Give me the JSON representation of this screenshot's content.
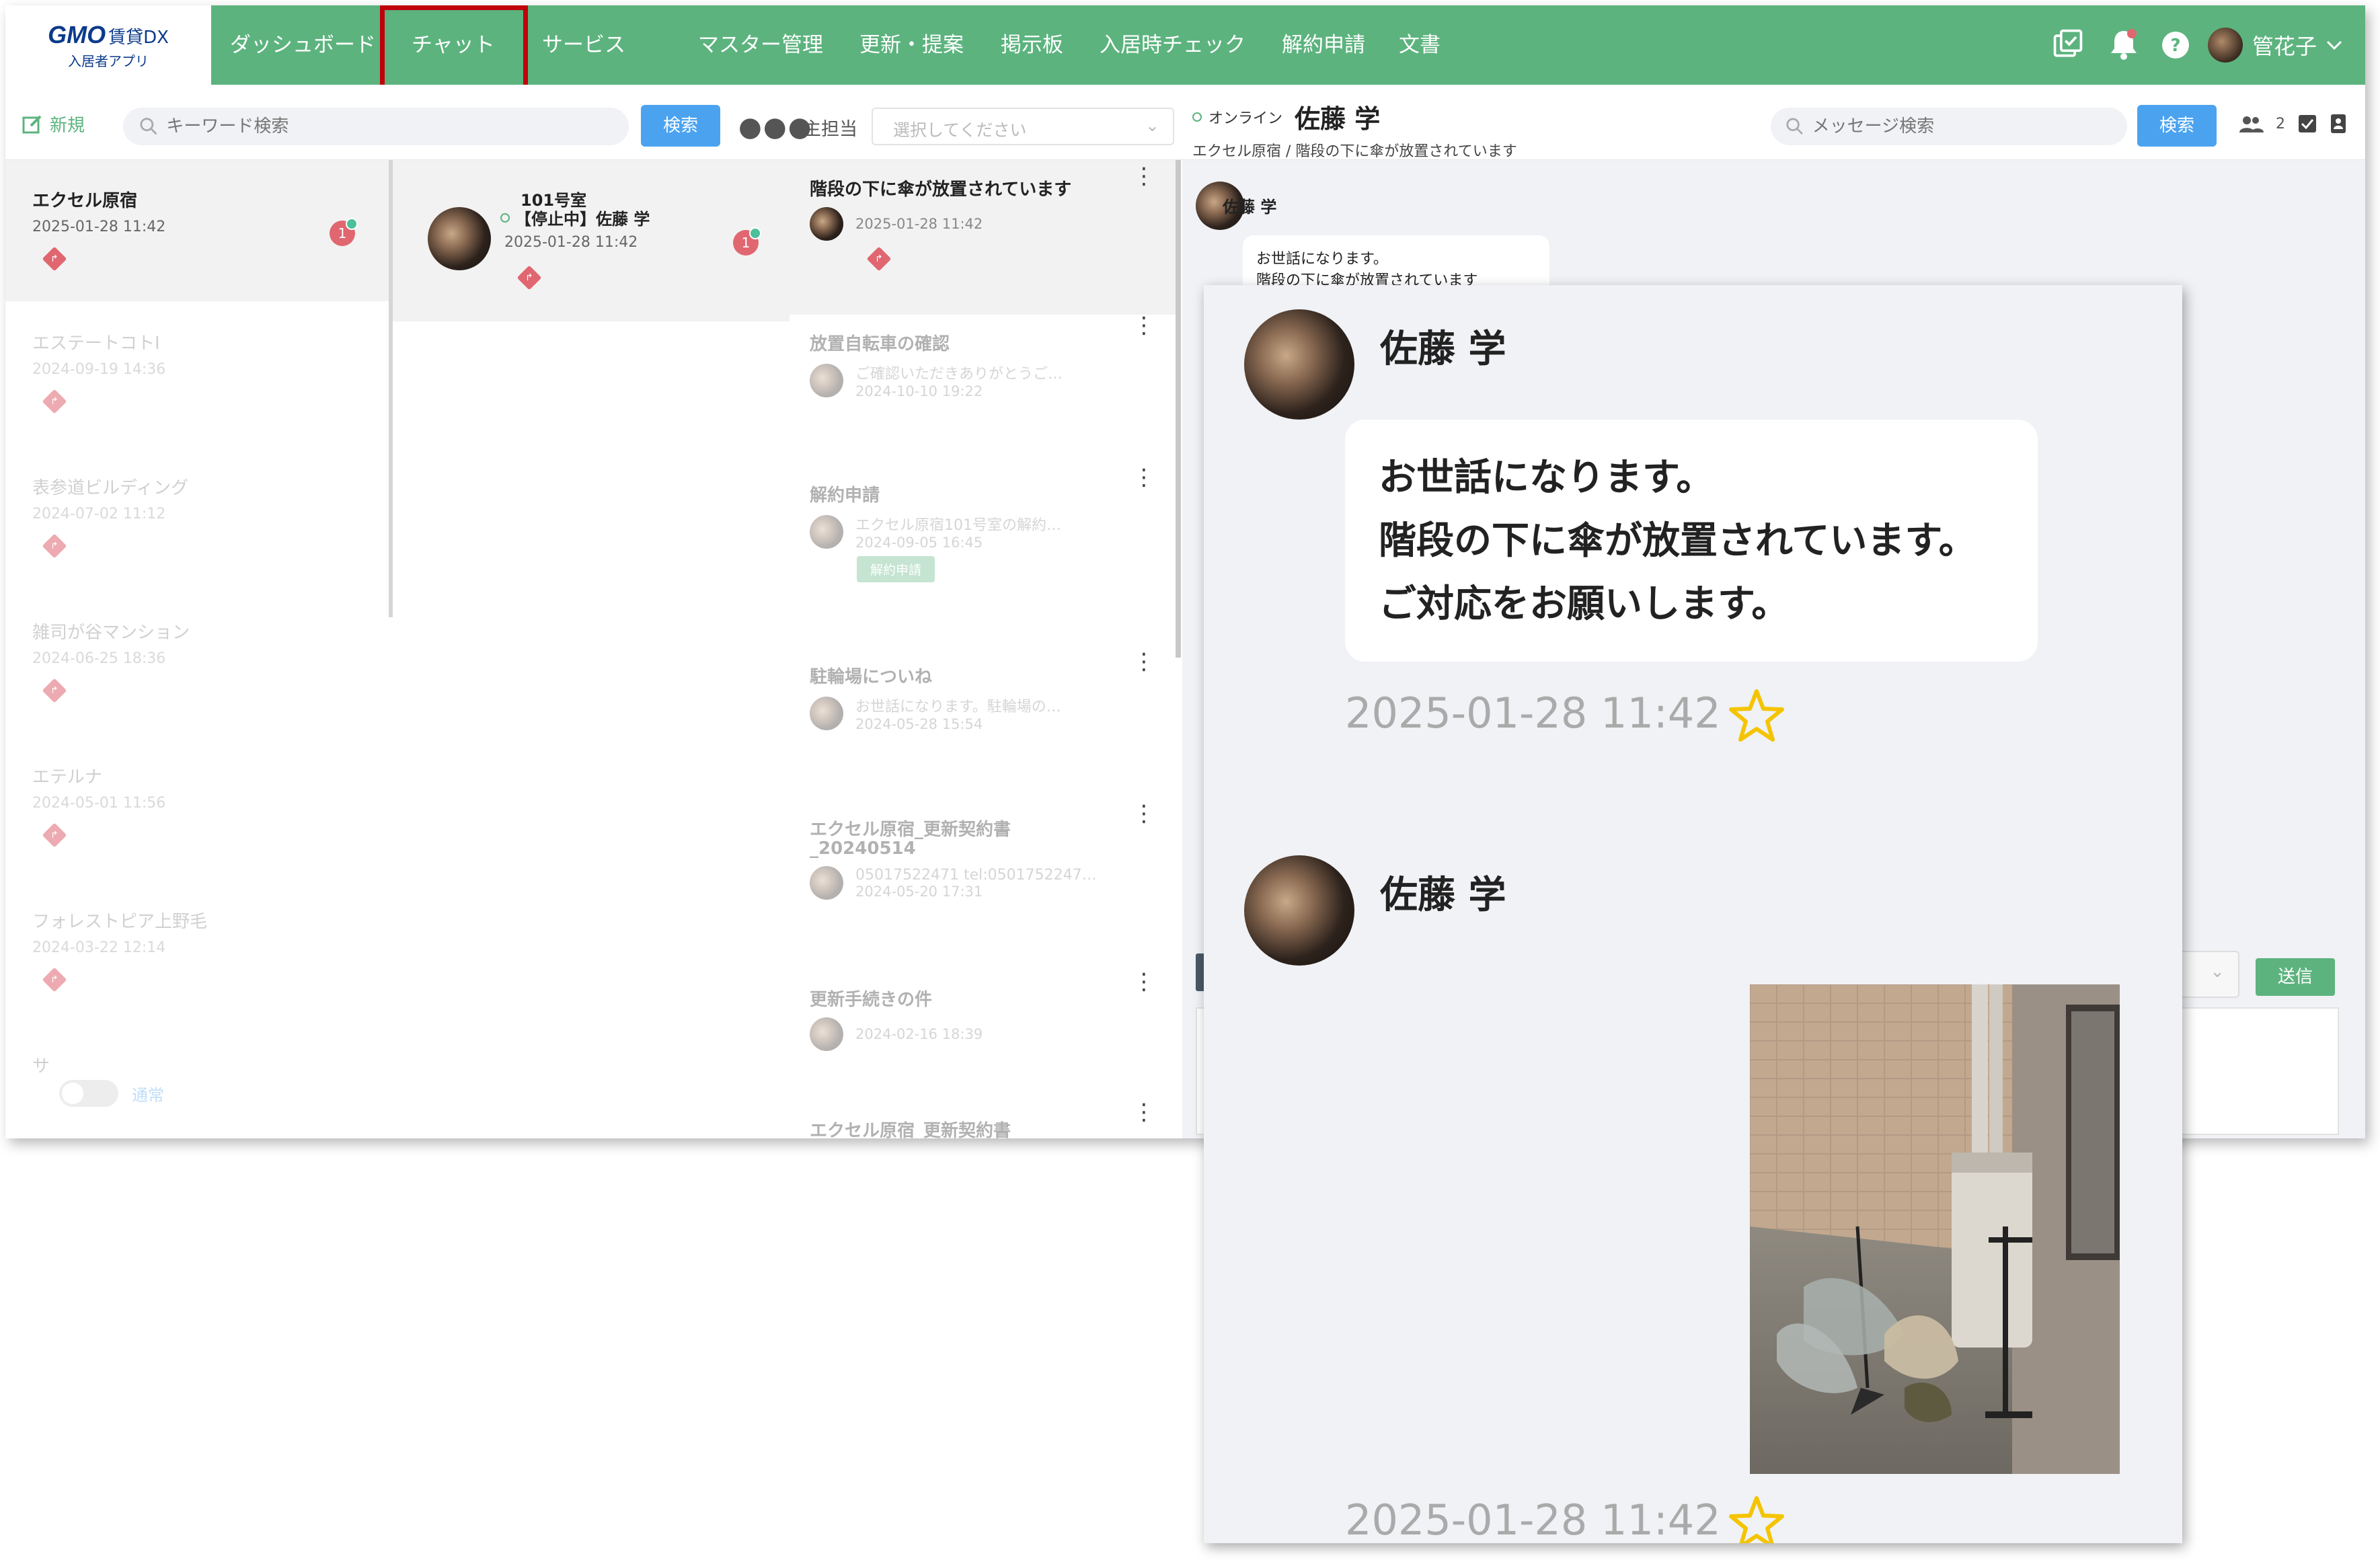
{
  "app": {
    "logo_brand": "GMO",
    "logo_product": "賃貸DX",
    "logo_subtitle": "入居者アプリ"
  },
  "nav": {
    "items": [
      {
        "label": "ダッシュボード"
      },
      {
        "label": "チャット"
      },
      {
        "label": "サービス"
      },
      {
        "label": "マスター管理"
      },
      {
        "label": "更新・提案"
      },
      {
        "label": "掲示板"
      },
      {
        "label": "入居時チェック"
      },
      {
        "label": "解約申請"
      },
      {
        "label": "文書"
      }
    ],
    "active": "チャット",
    "user_name": "管花子"
  },
  "toolbar": {
    "new_label": "新規",
    "search_placeholder": "キーワード検索",
    "search_button": "検索",
    "assignee_label": "主担当",
    "assignee_placeholder": "選択してください",
    "chat_status": "オンライン",
    "chat_name": "佐藤 学",
    "chat_breadcrumb": "エクセル原宿 / 階段の下に傘が放置されています",
    "message_search_placeholder": "メッセージ検索",
    "message_search_button": "検索",
    "member_count": "2"
  },
  "properties": [
    {
      "name": "エクセル原宿",
      "date": "2025-01-28 11:42",
      "badge": "1"
    },
    {
      "name": "エステートコトⅠ",
      "date": "2024-09-19 14:36"
    },
    {
      "name": "表参道ビルディング",
      "date": "2024-07-02 11:12"
    },
    {
      "name": "雑司が谷マンション",
      "date": "2024-06-25 18:36"
    },
    {
      "name": "エテルナ",
      "date": "2024-05-01 11:56"
    },
    {
      "name": "フォレストピア上野毛",
      "date": "2024-03-22 12:14"
    },
    {
      "name": "サ"
    }
  ],
  "toggle_label": "通常",
  "room": {
    "room_no": "101号室",
    "tenant": "【停止中】佐藤 学",
    "date": "2025-01-28 11:42",
    "badge": "1"
  },
  "threads": [
    {
      "title": "階段の下に傘が放置されています",
      "date": "2025-01-28 11:42"
    },
    {
      "title": "放置自転車の確認",
      "snippet": "ご確認いただきありがとうご…",
      "date": "2024-10-10 19:22"
    },
    {
      "title": "解約申請",
      "snippet": "エクセル原宿101号室の解約…",
      "date": "2024-09-05 16:45",
      "tag": "解約申請"
    },
    {
      "title": "駐輪場についね",
      "snippet": "お世話になります。駐輪場の…",
      "date": "2024-05-28 15:54"
    },
    {
      "title": "エクセル原宿_更新契約書_20240514",
      "snippet": "05017522471 tel:0501752247…",
      "date": "2024-05-20 17:31"
    },
    {
      "title": "更新手続きの件",
      "date": "2024-02-16 18:39"
    },
    {
      "title": "エクセル原宿_更新契約書"
    }
  ],
  "chat": {
    "sender": "佐藤 学",
    "small_preview_line1": "お世話になります。",
    "small_preview_line2": "階段の下に傘が放置されています",
    "send_button": "送信"
  },
  "zoom": {
    "sender": "佐藤 学",
    "message_lines": [
      "お世話になります。",
      "階段の下に傘が放置されています。",
      "ご対応をお願いします。"
    ],
    "time": "2025-01-28 11:42",
    "sender2": "佐藤 学",
    "time2": "2025-01-28 11:42"
  },
  "colors": {
    "nav_green": "#5cb37e",
    "highlight_red": "#c0000b",
    "button_blue": "#4ba3f0",
    "badge_red": "#e06670",
    "star_yellow": "#f5c400"
  }
}
